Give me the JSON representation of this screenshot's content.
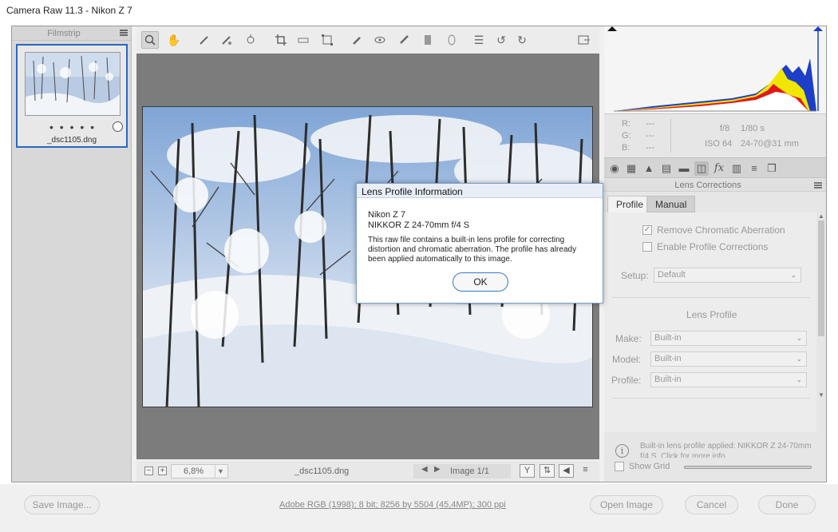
{
  "window": {
    "title": "Camera Raw 11.3  -  Nikon Z 7"
  },
  "filmstrip": {
    "title": "Filmstrip",
    "item": {
      "rating_dots": "• • • • •",
      "filename": "_dsc1105.dng"
    }
  },
  "toolbar": {
    "tools": [
      "zoom-icon",
      "hand-icon",
      "white-balance-icon",
      "color-sampler-icon",
      "targeted-adjustment-icon",
      "crop-icon",
      "straighten-icon",
      "transform-icon",
      "spot-removal-icon",
      "red-eye-icon",
      "adjustment-brush-icon",
      "graduated-filter-icon",
      "radial-filter-icon",
      "preferences-icon",
      "rotate-left-icon",
      "rotate-right-icon",
      "fullscreen-icon"
    ],
    "active_tool": "zoom-icon"
  },
  "statusbar": {
    "zoom_out": "−",
    "zoom_in": "+",
    "zoom_value": "6,8%",
    "filename": "_dsc1105.dng",
    "page_label": "Image 1/1"
  },
  "histogram": {
    "r_label": "R:",
    "r_value": "---",
    "g_label": "G:",
    "g_value": "---",
    "b_label": "B:",
    "b_value": "---",
    "aperture": "f/8",
    "shutter": "1/80 s",
    "iso": "ISO 64",
    "lens": "24-70@31 mm"
  },
  "panel": {
    "section_title": "Lens Corrections",
    "tabs": {
      "profile": "Profile",
      "manual": "Manual"
    },
    "remove_ca": "Remove Chromatic Aberration",
    "enable_profile": "Enable Profile Corrections",
    "setup_label": "Setup:",
    "setup_value": "Default",
    "lens_profile_heading": "Lens Profile",
    "make_label": "Make:",
    "make_value": "Built-in",
    "model_label": "Model:",
    "model_value": "Built-in",
    "profile_label": "Profile:",
    "profile_value": "Built-in",
    "info_text": "Built-in lens profile applied: NIKKOR Z 24-70mm f/4 S.  Click for more info.",
    "show_grid": "Show Grid"
  },
  "dialog": {
    "title": "Lens Profile Information",
    "camera": "Nikon Z 7",
    "lens": "NIKKOR Z 24-70mm f/4 S",
    "message": "This raw file contains a built-in lens profile for correcting distortion and chromatic aberration. The profile has already been applied automatically to this image.",
    "ok": "OK"
  },
  "bottom": {
    "save": "Save Image...",
    "workflow": "Adobe RGB (1998); 8 bit; 8256 by 5504 (45,4MP); 300 ppi",
    "open": "Open Image",
    "cancel": "Cancel",
    "done": "Done"
  },
  "colors": {
    "accent": "#2a66c5",
    "dialog_border": "#7a9cc7",
    "preview_bg": "#7c7c7c"
  }
}
